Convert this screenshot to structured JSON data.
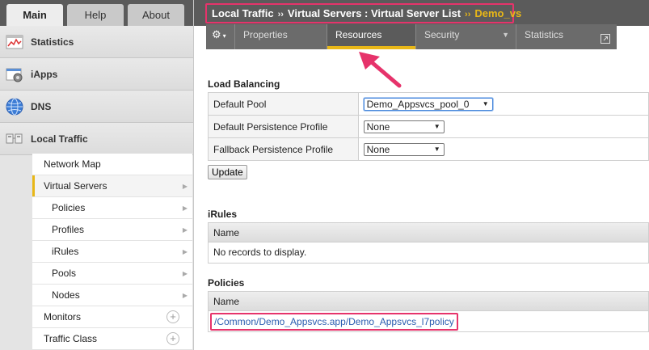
{
  "top_tabs": [
    {
      "label": "Main",
      "active": true
    },
    {
      "label": "Help",
      "active": false
    },
    {
      "label": "About",
      "active": false
    }
  ],
  "nav": {
    "sections": [
      {
        "label": "Statistics",
        "icon": "statistics-icon"
      },
      {
        "label": "iApps",
        "icon": "iapps-icon"
      },
      {
        "label": "DNS",
        "icon": "dns-globe-icon"
      },
      {
        "label": "Local Traffic",
        "icon": "local-traffic-icon"
      }
    ],
    "local_traffic_items": [
      {
        "label": "Network Map",
        "indent": false,
        "active": false,
        "marker": ""
      },
      {
        "label": "Virtual Servers",
        "indent": false,
        "active": true,
        "marker": "arrow"
      },
      {
        "label": "Policies",
        "indent": true,
        "active": false,
        "marker": "arrow"
      },
      {
        "label": "Profiles",
        "indent": true,
        "active": false,
        "marker": "arrow"
      },
      {
        "label": "iRules",
        "indent": true,
        "active": false,
        "marker": "arrow"
      },
      {
        "label": "Pools",
        "indent": true,
        "active": false,
        "marker": "arrow"
      },
      {
        "label": "Nodes",
        "indent": true,
        "active": false,
        "marker": "arrow"
      },
      {
        "label": "Monitors",
        "indent": false,
        "active": false,
        "marker": "plus"
      },
      {
        "label": "Traffic Class",
        "indent": false,
        "active": false,
        "marker": "plus"
      }
    ]
  },
  "breadcrumb": {
    "part1": "Local Traffic",
    "sep": "››",
    "part2": "Virtual Servers : Virtual Server List",
    "current": "Demo_vs"
  },
  "tabs": [
    {
      "label": "Properties",
      "active": false,
      "dropdown": false,
      "icon": ""
    },
    {
      "label": "Resources",
      "active": true,
      "dropdown": false,
      "icon": ""
    },
    {
      "label": "Security",
      "active": false,
      "dropdown": true,
      "icon": ""
    },
    {
      "label": "Statistics",
      "active": false,
      "dropdown": false,
      "icon": "external-link-icon"
    }
  ],
  "load_balancing": {
    "title": "Load Balancing",
    "rows": [
      {
        "label": "Default Pool",
        "value": "Demo_Appsvcs_pool_0"
      },
      {
        "label": "Default Persistence Profile",
        "value": "None"
      },
      {
        "label": "Fallback Persistence Profile",
        "value": "None"
      }
    ],
    "update_label": "Update"
  },
  "irules": {
    "title": "iRules",
    "column": "Name",
    "empty_text": "No records to display."
  },
  "policies": {
    "title": "Policies",
    "column": "Name",
    "link": "/Common/Demo_Appsvcs.app/Demo_Appsvcs_l7policy"
  },
  "colors": {
    "highlight": "#e6336b",
    "accent": "#e8b717",
    "header_bg": "#5b5b5b",
    "link": "#2a5db0"
  }
}
